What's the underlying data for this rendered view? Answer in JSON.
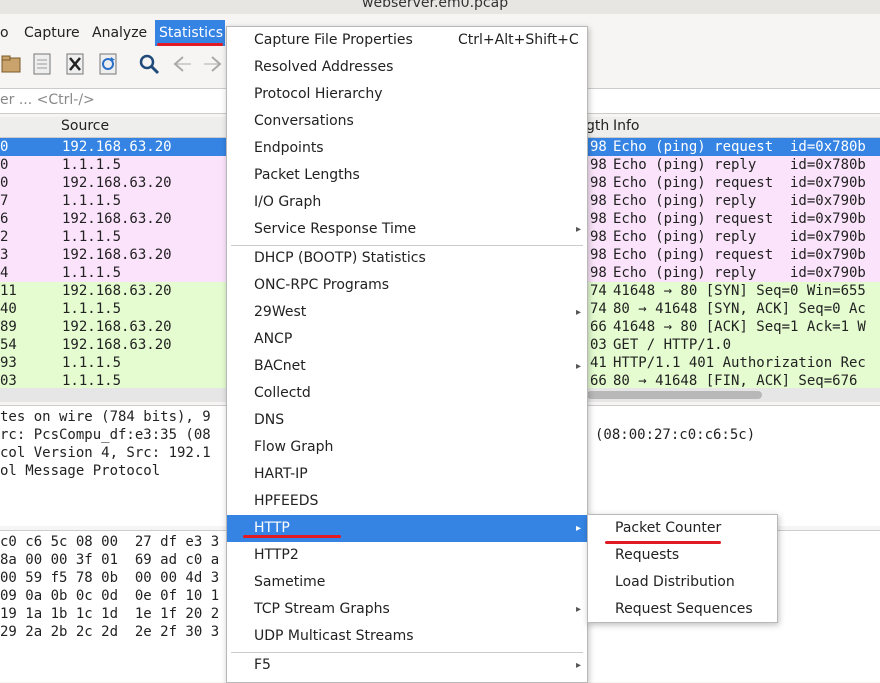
{
  "window": {
    "title": "webserver.em0.pcap"
  },
  "menubar": {
    "items": [
      "o",
      "Capture",
      "Analyze",
      "Statistics"
    ],
    "active": "Statistics"
  },
  "filter": {
    "placeholder": "er ... <Ctrl-/>"
  },
  "packet_list": {
    "columns": [
      "Source",
      "gth",
      "Info"
    ],
    "rows": [
      {
        "no": "0",
        "source": "192.168.63.20",
        "len": "98",
        "info": "Echo (ping) request  id=0x780b",
        "color": "#3584e4",
        "selected": true
      },
      {
        "no": "0",
        "source": "1.1.1.5",
        "len": "98",
        "info": "Echo (ping) reply    id=0x780b",
        "color": "#fbe4fb"
      },
      {
        "no": "0",
        "source": "192.168.63.20",
        "len": "98",
        "info": "Echo (ping) request  id=0x790b",
        "color": "#fbe4fb"
      },
      {
        "no": "7",
        "source": "1.1.1.5",
        "len": "98",
        "info": "Echo (ping) reply    id=0x790b",
        "color": "#fbe4fb"
      },
      {
        "no": "6",
        "source": "192.168.63.20",
        "len": "98",
        "info": "Echo (ping) request  id=0x790b",
        "color": "#fbe4fb"
      },
      {
        "no": "2",
        "source": "1.1.1.5",
        "len": "98",
        "info": "Echo (ping) reply    id=0x790b",
        "color": "#fbe4fb"
      },
      {
        "no": "3",
        "source": "192.168.63.20",
        "len": "98",
        "info": "Echo (ping) request  id=0x790b",
        "color": "#fbe4fb"
      },
      {
        "no": "4",
        "source": "1.1.1.5",
        "len": "98",
        "info": "Echo (ping) reply    id=0x790b",
        "color": "#fbe4fb"
      },
      {
        "no": "11",
        "source": "192.168.63.20",
        "len": "74",
        "info": "41648 → 80 [SYN] Seq=0 Win=655",
        "color": "#e4fcd0"
      },
      {
        "no": "40",
        "source": "1.1.1.5",
        "len": "74",
        "info": "80 → 41648 [SYN, ACK] Seq=0 Ac",
        "color": "#e4fcd0"
      },
      {
        "no": "89",
        "source": "192.168.63.20",
        "len": "66",
        "info": "41648 → 80 [ACK] Seq=1 Ack=1 W",
        "color": "#e4fcd0"
      },
      {
        "no": "54",
        "source": "192.168.63.20",
        "len": "03",
        "info": "GET / HTTP/1.0",
        "color": "#e4fcd0"
      },
      {
        "no": "93",
        "source": "1.1.1.5",
        "len": "41",
        "info": "HTTP/1.1 401 Authorization Rec",
        "color": "#e4fcd0"
      },
      {
        "no": "03",
        "source": "1.1.1.5",
        "len": "66",
        "info": "80 → 41648 [FIN, ACK] Seq=676",
        "color": "#e4fcd0"
      }
    ]
  },
  "details": [
    "tes on wire (784 bits), 9",
    "rc: PcsCompu_df:e3:35 (08",
    "col Version 4, Src: 192.1",
    "ol Message Protocol"
  ],
  "details_right": "(08:00:27:c0:c6:5c)",
  "bytes": [
    "c0 c6 5c 08 00  27 df e3 3",
    "8a 00 00 3f 01  69 ad c0 a",
    "00 59 f5 78 0b  00 00 4d 3",
    "09 0a 0b 0c 0d  0e 0f 10 1",
    "19 1a 1b 1c 1d  1e 1f 20 2",
    "29 2a 2b 2c 2d  2e 2f 30 3"
  ],
  "statistics_menu": {
    "items": [
      {
        "label": "Capture File Properties",
        "shortcut": "Ctrl+Alt+Shift+C"
      },
      {
        "label": "Resolved Addresses"
      },
      {
        "label": "Protocol Hierarchy"
      },
      {
        "label": "Conversations"
      },
      {
        "label": "Endpoints"
      },
      {
        "label": "Packet Lengths"
      },
      {
        "label": "I/O Graph"
      },
      {
        "label": "Service Response Time",
        "submenu": true
      },
      {
        "label": "DHCP (BOOTP) Statistics"
      },
      {
        "label": "ONC-RPC Programs"
      },
      {
        "label": "29West",
        "submenu": true
      },
      {
        "label": "ANCP"
      },
      {
        "label": "BACnet",
        "submenu": true
      },
      {
        "label": "Collectd"
      },
      {
        "label": "DNS"
      },
      {
        "label": "Flow Graph"
      },
      {
        "label": "HART-IP"
      },
      {
        "label": "HPFEEDS"
      },
      {
        "label": "HTTP",
        "submenu": true,
        "highlighted": true
      },
      {
        "label": "HTTP2"
      },
      {
        "label": "Sametime"
      },
      {
        "label": "TCP Stream Graphs",
        "submenu": true
      },
      {
        "label": "UDP Multicast Streams"
      },
      {
        "label": "F5",
        "submenu": true
      }
    ]
  },
  "http_submenu": {
    "items": [
      "Packet Counter",
      "Requests",
      "Load Distribution",
      "Request Sequences"
    ]
  },
  "colors": {
    "selection": "#3584e4",
    "icmp_row": "#fbe4fb",
    "tcp_row": "#e4fcd0",
    "annotation": "#e01b24"
  }
}
